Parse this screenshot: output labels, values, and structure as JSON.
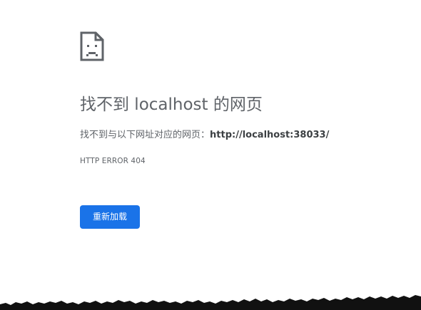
{
  "icon": "sad-page-icon",
  "title": "找不到 localhost 的网页",
  "message": {
    "prefix": "找不到与以下网址对应的网页：",
    "url": "http://localhost:38033/"
  },
  "error_code": "HTTP ERROR 404",
  "reload_button_label": "重新加载",
  "colors": {
    "text": "#5f6368",
    "url_text": "#3c4043",
    "button_bg": "#1a73e8",
    "button_text": "#ffffff",
    "background": "#ffffff"
  }
}
